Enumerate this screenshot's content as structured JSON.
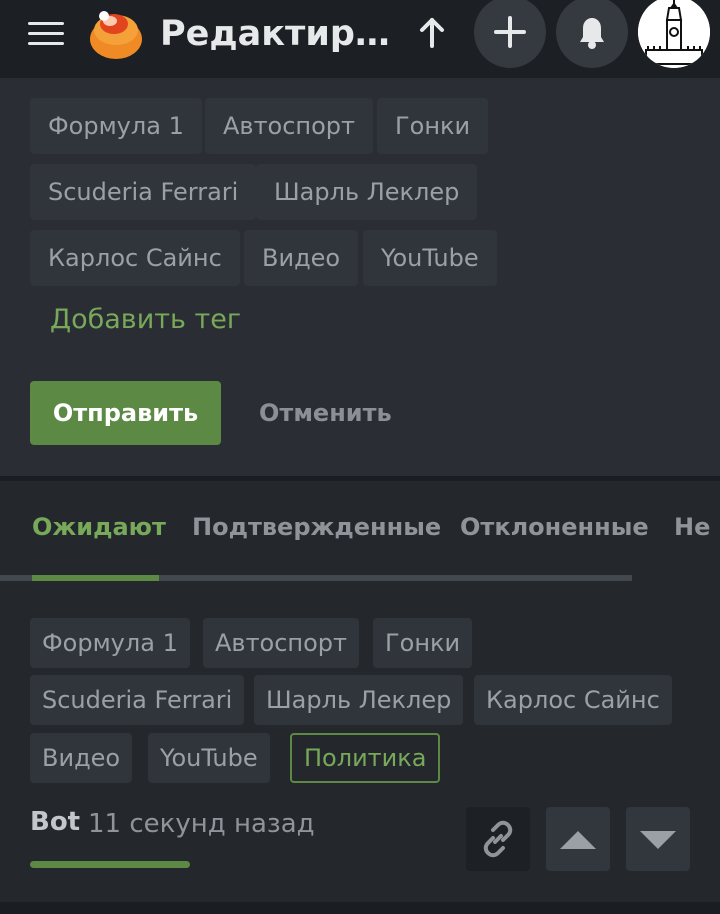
{
  "header": {
    "title": "Редактиров...",
    "icons": {
      "menu": "hamburger-menu-icon",
      "logo": "site-logo",
      "up": "arrow-up-icon",
      "plus": "plus-icon",
      "bell": "bell-icon",
      "avatar": "kremlin-tower-avatar"
    }
  },
  "editor": {
    "tags": [
      "Формула 1",
      "Автоспорт",
      "Гонки",
      "Scuderia Ferrari",
      "Шарль Леклер",
      "Карлос Сайнс",
      "Видео",
      "YouTube"
    ],
    "add_tag_label": "Добавить тег",
    "submit_label": "Отправить",
    "cancel_label": "Отменить"
  },
  "moderation": {
    "tabs": [
      {
        "label": "Ожидают",
        "active": true
      },
      {
        "label": "Подтвержденные",
        "active": false
      },
      {
        "label": "Отклоненные",
        "active": false
      },
      {
        "label": "Не и",
        "active": false
      }
    ],
    "entry": {
      "tags": [
        "Формула 1",
        "Автоспорт",
        "Гонки",
        "Scuderia Ferrari",
        "Шарль Леклер",
        "Карлос Сайнс",
        "Видео",
        "YouTube",
        "Политика"
      ],
      "highlighted_tag": "Политика",
      "author": "Bot",
      "time": "11 секунд назад",
      "actions": [
        "link-icon",
        "upvote-icon",
        "downvote-icon"
      ]
    }
  },
  "colors": {
    "accent_green": "#5c8a44",
    "accent_green_text": "#78a85a",
    "background": "#1c1f24",
    "panel": "#2a2e34"
  }
}
